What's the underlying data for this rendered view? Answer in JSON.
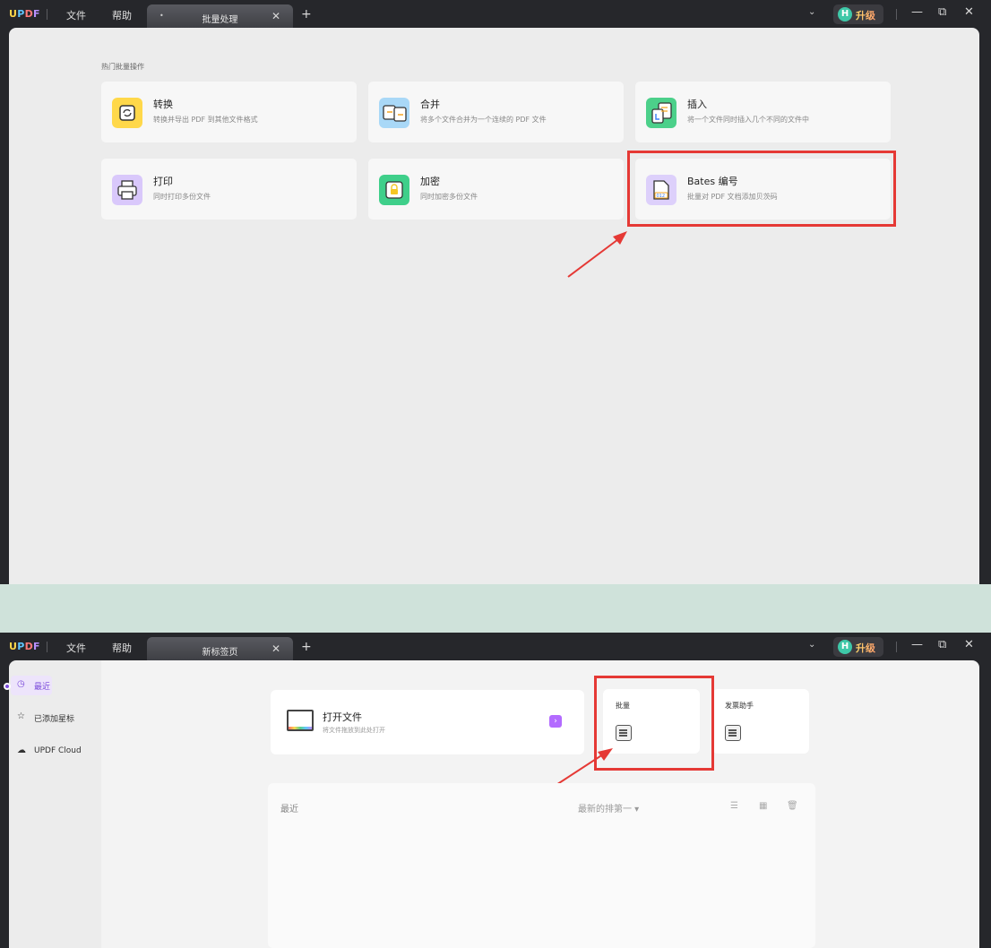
{
  "app": {
    "logo": "UPDF",
    "menu": [
      "文件",
      "帮助"
    ],
    "upgrade_avatar": "H",
    "upgrade_label": "升级"
  },
  "screen1": {
    "tab_title": "批量处理",
    "section_label": "热门批量操作",
    "cards": [
      {
        "title": "转换",
        "desc": "转换并导出 PDF 到其他文件格式",
        "icon": "convert-icon",
        "color": "#ffd84a"
      },
      {
        "title": "合并",
        "desc": "将多个文件合并为一个连续的 PDF 文件",
        "icon": "merge-icon",
        "color": "#a9d8f7"
      },
      {
        "title": "插入",
        "desc": "将一个文件同时插入几个不同的文件中",
        "icon": "insert-icon",
        "color": "#4cd08a"
      },
      {
        "title": "打印",
        "desc": "同时打印多份文件",
        "icon": "print-icon",
        "color": "#d9c8fb"
      },
      {
        "title": "加密",
        "desc": "同时加密多份文件",
        "icon": "lock-icon",
        "color": "#3fcf8a"
      },
      {
        "title": "Bates 编号",
        "desc": "批量对 PDF 文档添加贝茨码",
        "icon": "bates-icon",
        "color": "#ddd0fb"
      }
    ]
  },
  "screen2": {
    "tab_title": "新标签页",
    "sidebar": [
      {
        "label": "最近",
        "icon": "clock-icon"
      },
      {
        "label": "已添加星标",
        "icon": "star-icon"
      },
      {
        "label": "UPDF Cloud",
        "icon": "cloud-icon"
      }
    ],
    "open_file": {
      "title": "打开文件",
      "desc": "将文件拖放到此处打开"
    },
    "tools": [
      {
        "title": "批量"
      },
      {
        "title": "发票助手"
      }
    ],
    "recent": {
      "title": "最近",
      "sort": "最新的排第一 ▾"
    }
  }
}
